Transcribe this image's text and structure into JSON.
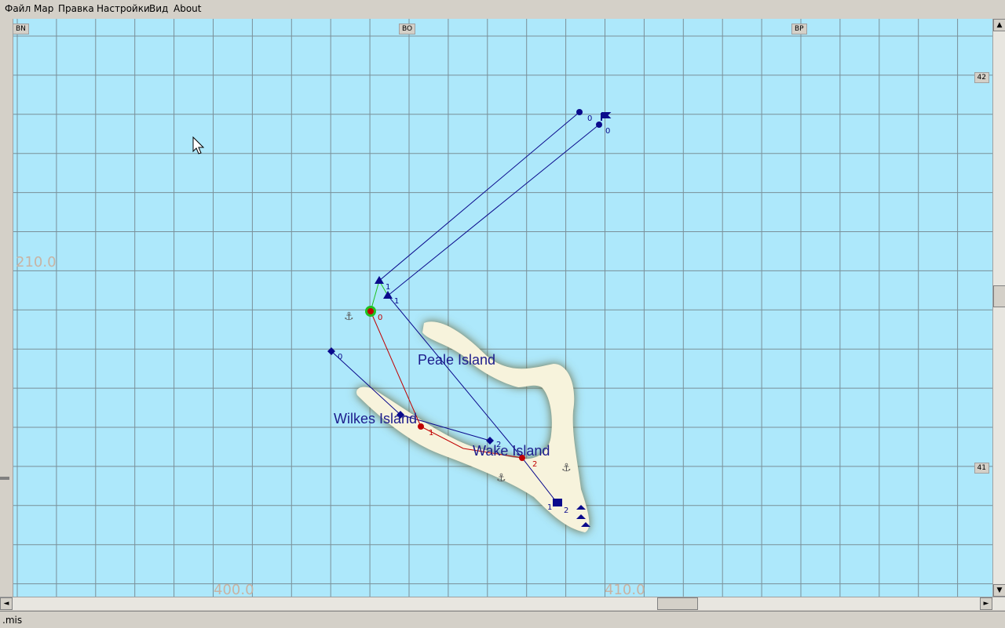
{
  "menu": [
    "Файл",
    "Мар",
    "Правка",
    "Настройки",
    "Вид",
    "About"
  ],
  "map": {
    "sectors": [
      "BN",
      "BO",
      "BP"
    ],
    "rows": [
      "42",
      "41"
    ],
    "coords": {
      "y_label": "210.0",
      "x_labels": [
        "400.0",
        "410.0"
      ]
    },
    "islands": [
      "Peale Island",
      "Wilkes Island",
      "Wake Island"
    ],
    "waypoint_labels": [
      "0",
      "0",
      "1",
      "1",
      "0",
      "0",
      "1",
      "2",
      "2",
      "1",
      "2"
    ],
    "colors": {
      "water": "#ade8fb",
      "grid": "#7a8f98",
      "land": "#f7f3dc",
      "blue_route": "#0a0a8c",
      "red_route": "#c00000",
      "green_route": "#20c020"
    }
  },
  "scrollbars": {
    "up": "▲",
    "down": "▼",
    "left": "◄",
    "right": "►"
  },
  "status": {
    "text": ".mis"
  }
}
